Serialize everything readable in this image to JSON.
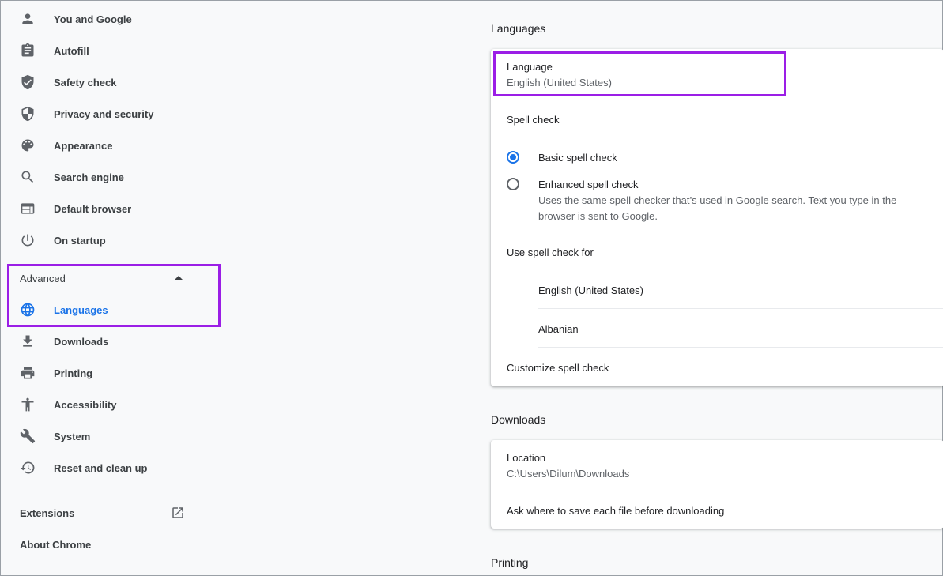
{
  "sidebar": {
    "items": [
      {
        "label": "You and Google",
        "icon": "person-icon"
      },
      {
        "label": "Autofill",
        "icon": "clipboard-icon"
      },
      {
        "label": "Safety check",
        "icon": "shield-check-icon"
      },
      {
        "label": "Privacy and security",
        "icon": "shield-half-icon"
      },
      {
        "label": "Appearance",
        "icon": "palette-icon"
      },
      {
        "label": "Search engine",
        "icon": "search-icon"
      },
      {
        "label": "Default browser",
        "icon": "browser-window-icon"
      },
      {
        "label": "On startup",
        "icon": "power-icon"
      }
    ],
    "advanced": {
      "label": "Advanced",
      "items": [
        {
          "label": "Languages",
          "icon": "globe-icon",
          "active": true
        },
        {
          "label": "Downloads",
          "icon": "download-icon"
        },
        {
          "label": "Printing",
          "icon": "printer-icon"
        },
        {
          "label": "Accessibility",
          "icon": "accessibility-icon"
        },
        {
          "label": "System",
          "icon": "wrench-icon"
        },
        {
          "label": "Reset and clean up",
          "icon": "restore-icon"
        }
      ]
    },
    "extensions": "Extensions",
    "about": "About Chrome"
  },
  "languages": {
    "title": "Languages",
    "language_label": "Language",
    "language_value": "English (United States)",
    "spell_check": "Spell check",
    "basic_spell_check": "Basic spell check",
    "enhanced_spell_check": "Enhanced spell check",
    "enhanced_desc_1": "Uses the same spell checker that’s used in Google search. Text you type in the",
    "enhanced_desc_2": "browser is sent to Google.",
    "use_spell_check_for": "Use spell check for",
    "spell_langs": [
      "English (United States)",
      "Albanian"
    ],
    "customize": "Customize spell check"
  },
  "downloads": {
    "title": "Downloads",
    "location_label": "Location",
    "location_value": "C:\\Users\\Dilum\\Downloads",
    "ask_where": "Ask where to save each file before downloading"
  },
  "printing": {
    "title": "Printing"
  },
  "colors": {
    "accent": "#1a73e8",
    "highlight": "#9b1ee6"
  }
}
